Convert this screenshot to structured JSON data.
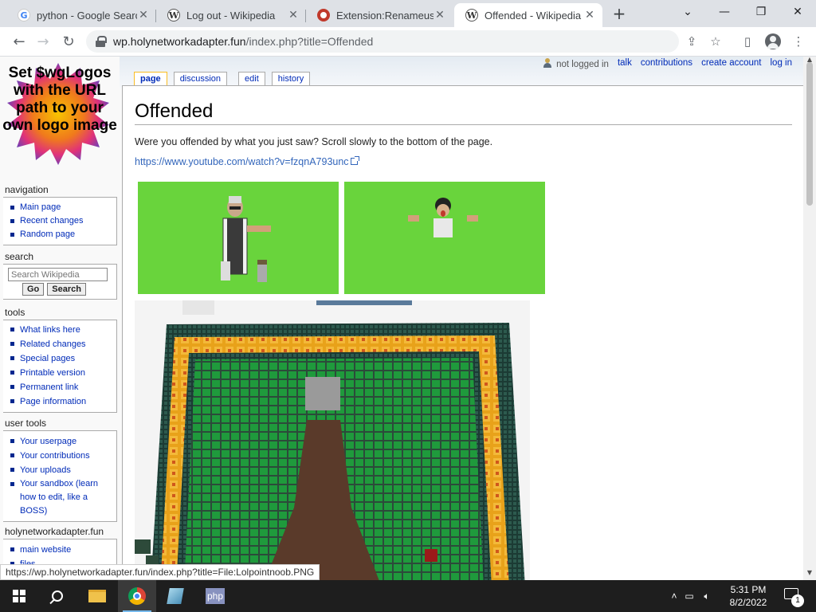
{
  "browser": {
    "tabs": [
      {
        "title": "python - Google Search",
        "favicon": "google-icon",
        "active": false
      },
      {
        "title": "Log out - Wikipedia",
        "favicon": "wikipedia-icon",
        "active": false
      },
      {
        "title": "Extension:Renameuser",
        "favicon": "mediawiki-icon",
        "active": false
      },
      {
        "title": "Offended - Wikipedia",
        "favicon": "wikipedia-icon",
        "active": true
      }
    ],
    "url_host": "wp.holynetworkadapter.fun",
    "url_path": "/index.php?title=Offended",
    "status_url": "https://wp.holynetworkadapter.fun/index.php?title=File:Lolpointnoob.PNG"
  },
  "wiki": {
    "logo_text": "Set $wgLogos with the URL path to your own logo image",
    "personal": {
      "not_logged_in": "not logged in",
      "talk": "talk",
      "contributions": "contributions",
      "create_account": "create account",
      "log_in": "log in"
    },
    "actions": {
      "page": "page",
      "discussion": "discussion",
      "edit": "edit",
      "history": "history"
    },
    "heading": "Offended",
    "body_text": "Were you offended by what you just saw? Scroll slowly to the bottom of the page.",
    "external_link": "https://www.youtube.com/watch?v=fzqnA793unc",
    "sidebar": {
      "navigation": {
        "title": "navigation",
        "items": [
          "Main page",
          "Recent changes",
          "Random page"
        ]
      },
      "search": {
        "title": "search",
        "placeholder": "Search Wikipedia",
        "go": "Go",
        "search": "Search"
      },
      "tools": {
        "title": "tools",
        "items": [
          "What links here",
          "Related changes",
          "Special pages",
          "Printable version",
          "Permanent link",
          "Page information"
        ]
      },
      "user_tools": {
        "title": "user tools",
        "items": [
          "Your userpage",
          "Your contributions",
          "Your uploads",
          "Your sandbox (learn how to edit, like a BOSS)"
        ]
      },
      "site": {
        "title": "holynetworkadapter.fun",
        "items": [
          "main website",
          "files"
        ]
      }
    }
  },
  "taskbar": {
    "time": "5:31 PM",
    "date": "8/2/2022",
    "php_label": "php",
    "notifications": "1"
  },
  "colors": {
    "link": "#002bb8",
    "green_screen": "#69d43c",
    "selected_tab_border": "#fabd23"
  }
}
